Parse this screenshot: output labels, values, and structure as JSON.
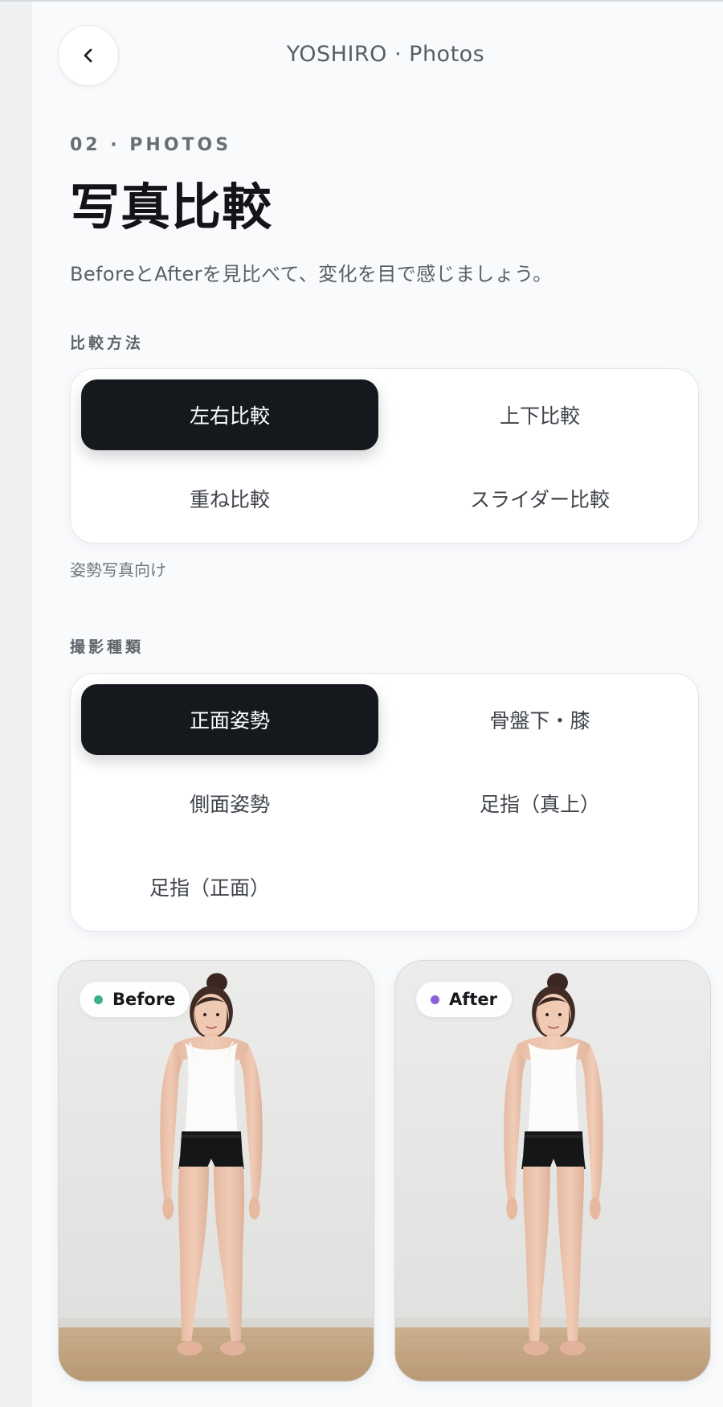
{
  "header": {
    "title": "YOSHIRO · Photos"
  },
  "intro": {
    "eyebrow": "02 · PHOTOS",
    "title": "写真比較",
    "subtitle": "BeforeとAfterを見比べて、変化を目で感じましょう。"
  },
  "compare_method": {
    "label": "比較方法",
    "selected": "左右比較",
    "options": [
      "左右比較",
      "上下比較",
      "重ね比較",
      "スライダー比較"
    ],
    "helper_text": "姿勢写真向け"
  },
  "capture_type": {
    "label": "撮影種類",
    "selected": "正面姿勢",
    "options": [
      "正面姿勢",
      "骨盤下・膝",
      "側面姿勢",
      "足指（真上）",
      "足指（正面）"
    ]
  },
  "photos": {
    "before": {
      "label": "Before",
      "dot_color": "#3ab08f"
    },
    "after": {
      "label": "After",
      "dot_color": "#8a61d6"
    }
  },
  "colors": {
    "page_background": "#f8fafc",
    "selected_option_background": "#15181d",
    "card_background": "#ffffff",
    "text_primary": "#121418",
    "text_secondary": "#5c6066"
  },
  "icons": {
    "back": "chevron-left-icon"
  }
}
